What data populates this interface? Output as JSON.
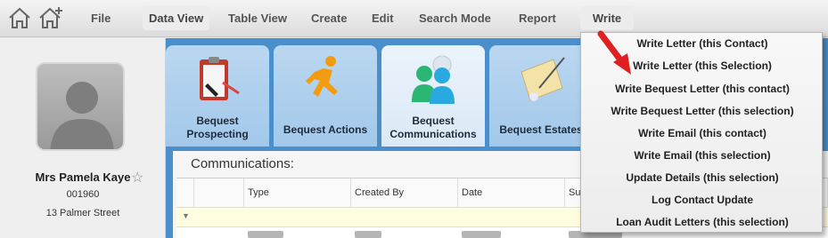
{
  "menu": {
    "items": [
      {
        "label": "File",
        "icon": "none"
      },
      {
        "label": "Data View",
        "active": true
      },
      {
        "label": "Table View"
      },
      {
        "label": "Create"
      },
      {
        "label": "Edit"
      },
      {
        "label": "Search Mode"
      },
      {
        "label": "Report"
      },
      {
        "label": "Write",
        "active": true
      }
    ],
    "icons": [
      "home-icon",
      "home-add-icon"
    ]
  },
  "contact": {
    "name": "Mrs Pamela Kaye",
    "id": "001960",
    "address": "13 Palmer Street",
    "avatar_icon": "person-silhouette-icon",
    "favorite_icon": "star-outline-icon"
  },
  "tabs": [
    {
      "label": "Bequest Prospecting",
      "icon": "clipboard-pen-icon"
    },
    {
      "label": "Bequest Actions",
      "icon": "running-man-icon"
    },
    {
      "label": "Bequest Communications",
      "icon": "people-chat-icon",
      "active": true
    },
    {
      "label": "Bequest Estates",
      "icon": "scroll-quill-icon"
    }
  ],
  "communications": {
    "title": "Communications:",
    "columns": [
      "Type",
      "Created By",
      "Date",
      "Sub"
    ]
  },
  "write_menu": {
    "items": [
      "Write Letter (this Contact)",
      "Write Letter (this Selection)",
      "Write Bequest Letter (this contact)",
      "Write Bequest Letter (this selection)",
      "Write Email (this contact)",
      "Write Email (this selection)",
      "Update Details (this selection)",
      "Log Contact Update",
      "Loan Audit Letters (this selection)"
    ]
  },
  "colors": {
    "accent_blue": "#4a8ecb",
    "annotation_arrow": "#e02020"
  }
}
